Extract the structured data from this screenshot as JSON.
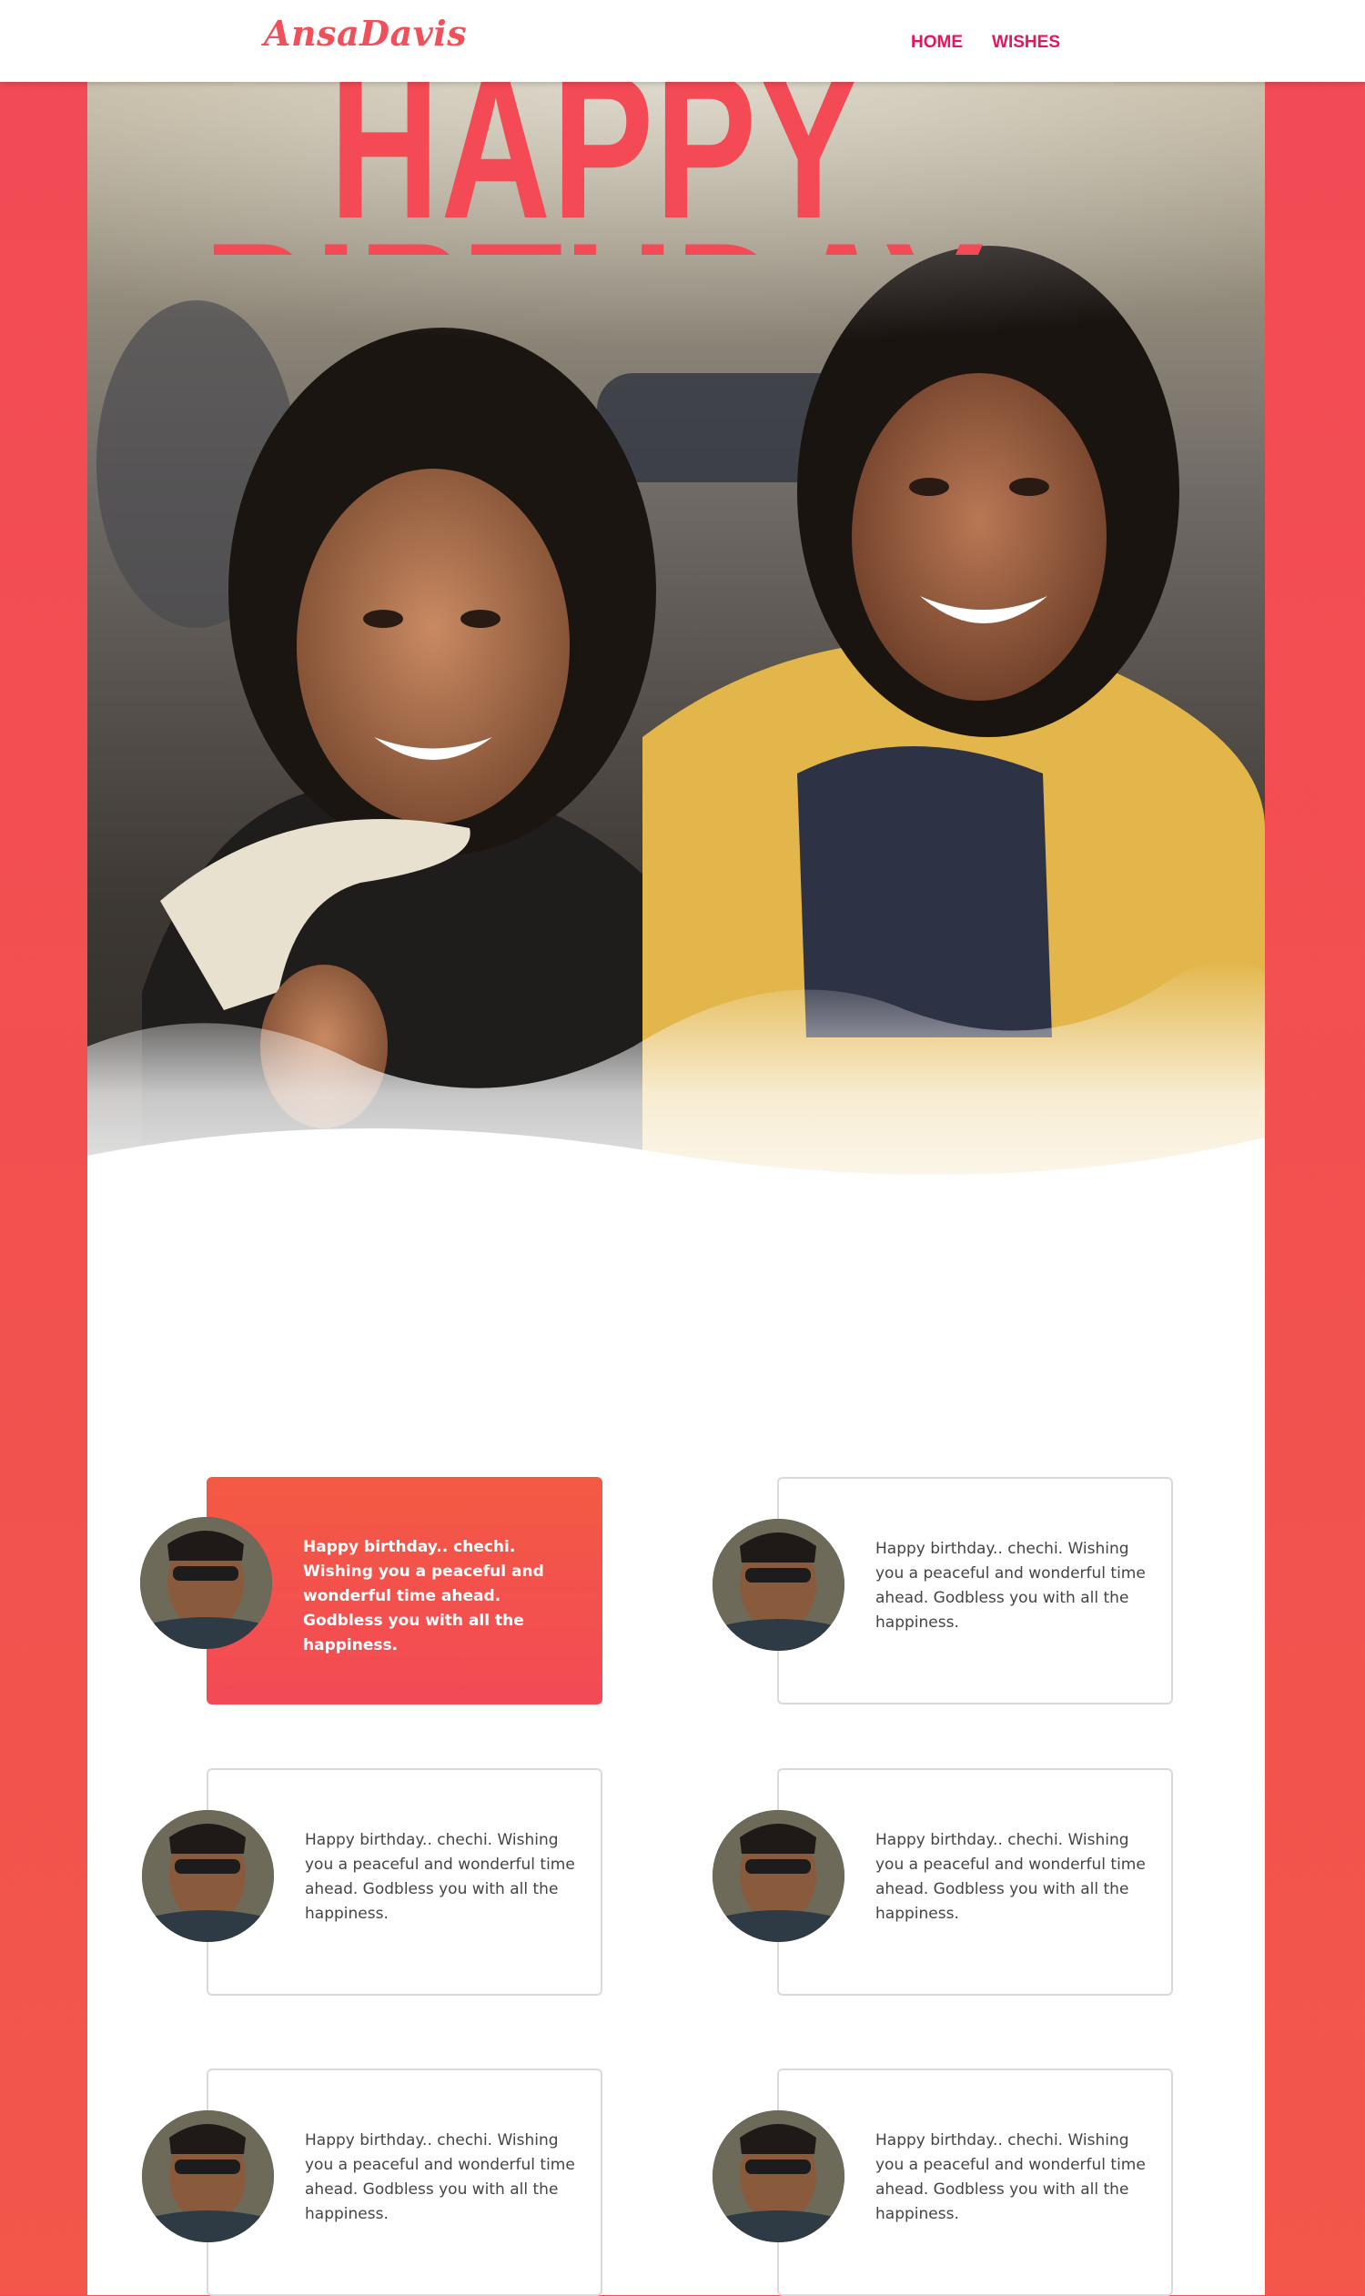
{
  "header": {
    "logo": "AnsaDavis",
    "nav": [
      {
        "label": "HOME"
      },
      {
        "label": "WISHES"
      }
    ]
  },
  "hero": {
    "title": "HAPPY BIRTHDAY"
  },
  "wishes": [
    {
      "text": "Happy birthday.. chechi. Wishing you a peaceful and wonderful time ahead. Godbless you with all the happiness.",
      "highlighted": true
    },
    {
      "text": "Happy birthday.. chechi. Wishing you a peaceful and wonderful time ahead. Godbless you with all the happiness.",
      "highlighted": false
    },
    {
      "text": "Happy birthday.. chechi. Wishing you a peaceful and wonderful time ahead. Godbless you with all the happiness.",
      "highlighted": false
    },
    {
      "text": "Happy birthday.. chechi. Wishing you a peaceful and wonderful time ahead. Godbless you with all the happiness.",
      "highlighted": false
    },
    {
      "text": "Happy birthday.. chechi. Wishing you a peaceful and wonderful time ahead. Godbless you with all the happiness.",
      "highlighted": false
    },
    {
      "text": "Happy birthday.. chechi. Wishing you a peaceful and wonderful time ahead. Godbless you with all the happiness.",
      "highlighted": false
    }
  ],
  "colors": {
    "accent": "#f34a56",
    "nav": "#e6155e",
    "highlight_gradient_top": "#f35a43"
  }
}
